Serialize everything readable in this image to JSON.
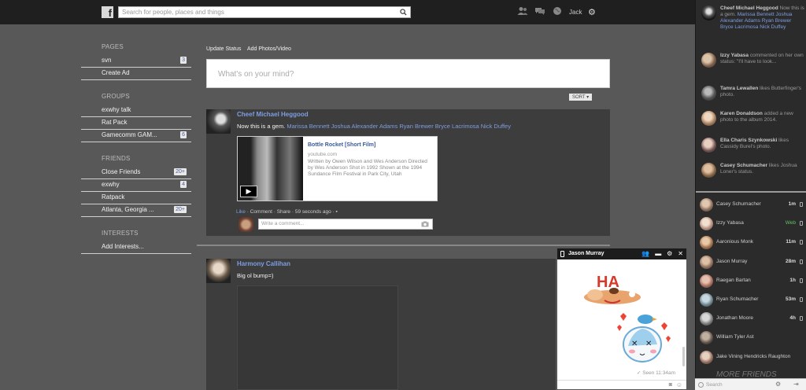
{
  "header": {
    "logo": "f",
    "search_placeholder": "Search for people, places and things",
    "user_name": "Jack"
  },
  "left_nav": {
    "pages_title": "PAGES",
    "pages": [
      {
        "label": "svn",
        "badge": "3"
      },
      {
        "label": "Create Ad",
        "badge": ""
      }
    ],
    "groups_title": "GROUPS",
    "groups": [
      {
        "label": "exwhy talk",
        "badge": ""
      },
      {
        "label": "Rat Pack",
        "badge": ""
      },
      {
        "label": "Gamecomm GAM...",
        "badge": "6"
      }
    ],
    "friends_title": "FRIENDS",
    "friends": [
      {
        "label": "Close Friends",
        "badge": "20+"
      },
      {
        "label": "exwhy",
        "badge": "4"
      },
      {
        "label": "Ratpack",
        "badge": ""
      },
      {
        "label": "Atlanta, Georgia ...",
        "badge": "20+"
      }
    ],
    "interests_title": "INTERESTS",
    "interests": [
      {
        "label": "Add Interests...",
        "badge": ""
      }
    ]
  },
  "composer": {
    "tab_status": "Update Status",
    "tab_photos": "Add Photos/Video",
    "placeholder": "What's on your mind?",
    "sort_label": "SORT ▾"
  },
  "posts": [
    {
      "author": "Cheef Michael Heggood",
      "text": "Now this is a gem.",
      "tags": "Marissa Bennett Joshua Alexander Adams Ryan Brewer Bryce Lacrimosa Nick Duffey",
      "link": {
        "title": "Bottle Rocket [Short Film]",
        "domain": "youtube.com",
        "description": "Written by Owen Wilson and Wes Anderson Directed by Wes Anderson Shot in 1992 Shown at the 1994 Sundance Film Festival in Park City, Utah"
      },
      "actions": {
        "like": "Like",
        "comment": "Comment",
        "share": "Share",
        "time": "59 seconds ago"
      },
      "comment_placeholder": "Write a comment..."
    },
    {
      "author": "Harmony Callihan",
      "text": "Big ol bump=)"
    }
  ],
  "chat": {
    "name": "Jason Murray",
    "seen": "✓ Seen 11:34am",
    "sticker_text": "HA"
  },
  "ticker": [
    {
      "name": "Cheef Michael Heggood",
      "text": "Now this is a gem.",
      "tags": "Marissa Bennett Joshua Alexander Adams Ryan Brewer Bryce Lacrimosa Nick Duffey"
    },
    {
      "name": "Izzy Yabasa",
      "text": "commented on her own status: \"I'll have to look...",
      "tags": ""
    },
    {
      "name": "Tamra Lewallen",
      "text": "likes Butterfinger's photo.",
      "tags": ""
    },
    {
      "name": "Karen Donaldson",
      "text": "added a new photo to the album 2014.",
      "tags": ""
    },
    {
      "name": "Ella Charis Szynkowski",
      "text": "likes Cassidy Burel's photo.",
      "tags": ""
    },
    {
      "name": "Casey Schumacher",
      "text": "likes Joshua Loner's status.",
      "tags": ""
    }
  ],
  "online_friends": [
    {
      "name": "Casey Schumacher",
      "status": "1m"
    },
    {
      "name": "Izzy Yabasa",
      "status": "Web"
    },
    {
      "name": "Aaronious Monk",
      "status": "11m"
    },
    {
      "name": "Jason Murray",
      "status": "28m"
    },
    {
      "name": "Raegan Bartan",
      "status": "1h"
    },
    {
      "name": "Ryan Schumacher",
      "status": "53m"
    },
    {
      "name": "Jonathan Moore",
      "status": "4h"
    },
    {
      "name": "William Tyler Ast",
      "status": ""
    },
    {
      "name": "Jake Vining Hendricks Raughton",
      "status": ""
    }
  ],
  "more_friends": "MORE FRIENDS",
  "sidebar_search_placeholder": "Search",
  "colors": {
    "link": "#7f9de0",
    "online": "#62c462",
    "topbar": "#1f1f1f"
  }
}
